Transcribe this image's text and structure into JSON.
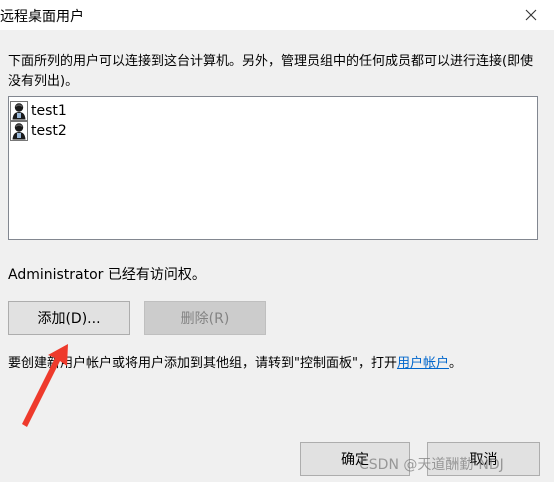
{
  "window": {
    "title": "远程桌面用户",
    "close_icon": "close-icon"
  },
  "intro_text": "下面所列的用户可以连接到这台计算机。另外，管理员组中的任何成员都可以进行连接(即使没有列出)。",
  "users": [
    {
      "name": "test1",
      "icon": "user-icon"
    },
    {
      "name": "test2",
      "icon": "user-icon"
    }
  ],
  "admin_note": "Administrator 已经有访问权。",
  "buttons": {
    "add_label": "添加(D)...",
    "remove_label": "删除(R)",
    "ok_label": "确定",
    "cancel_label": "取消"
  },
  "footer": {
    "text_before": "要创建新用户帐户或将用户添加到其他组，请转到\"控制面板\"，打开",
    "link_text": "用户帐户",
    "text_after": "。"
  },
  "watermark": "CSDN @天道酬勤-NDJ",
  "annotation": {
    "arrow_color": "#ee3a2c"
  }
}
